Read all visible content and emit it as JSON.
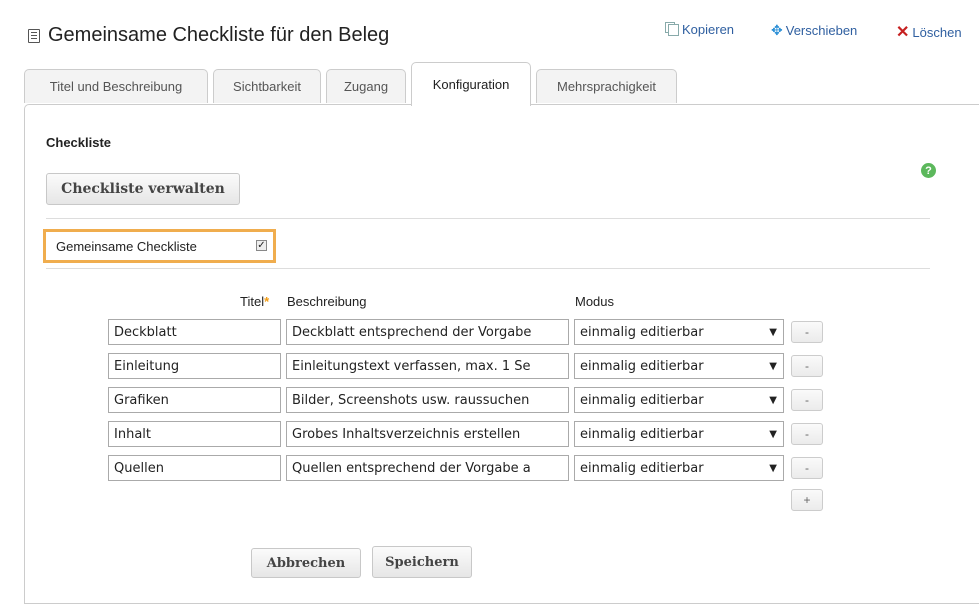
{
  "header": {
    "title": "Gemeinsame Checkliste für den Beleg",
    "actions": {
      "copy": "Kopieren",
      "move": "Verschieben",
      "delete": "Löschen"
    }
  },
  "tabs": [
    {
      "label": "Titel und Beschreibung"
    },
    {
      "label": "Sichtbarkeit"
    },
    {
      "label": "Zugang"
    },
    {
      "label": "Konfiguration",
      "active": true
    },
    {
      "label": "Mehrsprachigkeit"
    }
  ],
  "section": {
    "heading": "Checkliste",
    "manage_button": "Checkliste verwalten",
    "help_symbol": "?",
    "shared_label": "Gemeinsame Checkliste",
    "shared_checked": true
  },
  "table": {
    "headers": {
      "titel": "Titel",
      "required_mark": "*",
      "beschreibung": "Beschreibung",
      "modus": "Modus"
    },
    "rows": [
      {
        "titel": "Deckblatt",
        "beschreibung": "Deckblatt entsprechend der Vorgabe",
        "modus": "einmalig editierbar"
      },
      {
        "titel": "Einleitung",
        "beschreibung": "Einleitungstext verfassen, max. 1 Se",
        "modus": "einmalig editierbar"
      },
      {
        "titel": "Grafiken",
        "beschreibung": "Bilder, Screenshots usw. raussuchen",
        "modus": "einmalig editierbar"
      },
      {
        "titel": "Inhalt",
        "beschreibung": "Grobes Inhaltsverzeichnis erstellen",
        "modus": "einmalig editierbar"
      },
      {
        "titel": "Quellen",
        "beschreibung": "Quellen entsprechend der Vorgabe a",
        "modus": "einmalig editierbar"
      }
    ],
    "remove_label": "-",
    "add_label": "+"
  },
  "footer": {
    "cancel": "Abbrechen",
    "save": "Speichern"
  },
  "colors": {
    "highlight": "#f0ad4e",
    "link": "#2f5fa0",
    "delete": "#c62020",
    "help": "#5cb85c"
  }
}
